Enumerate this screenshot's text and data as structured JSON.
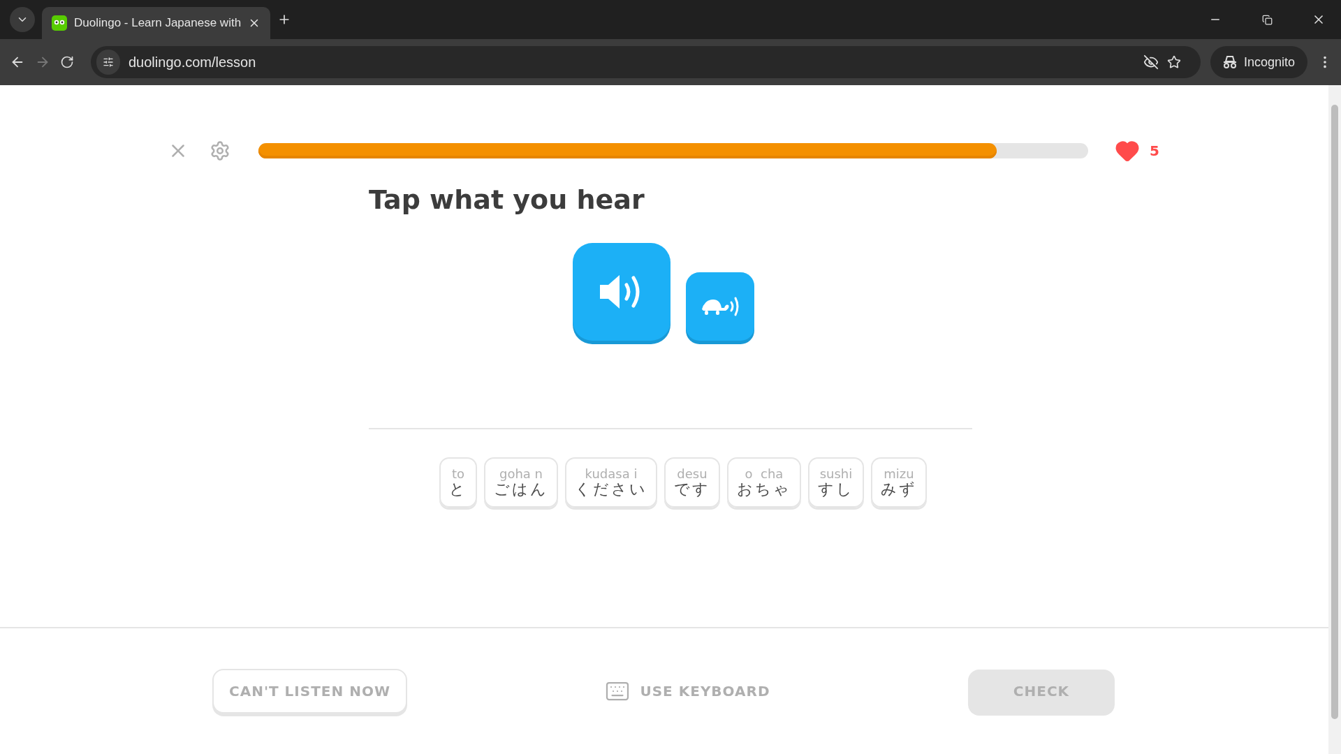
{
  "browser": {
    "tabs": [
      {
        "title": "Duolingo - Learn Japanese with",
        "selected": true
      }
    ],
    "url": "duolingo.com/lesson",
    "profile": "Incognito"
  },
  "lesson": {
    "progress": {
      "level": 0.89
    },
    "hearts": "5",
    "prompt": "Tap what you hear",
    "tiles": [
      {
        "reading": "to",
        "text": "と"
      },
      {
        "reading": "goha n",
        "text": "ごはん"
      },
      {
        "reading": "kudasa i",
        "text": "ください"
      },
      {
        "reading": "desu",
        "text": "です"
      },
      {
        "reading": "o  cha",
        "text": "おちゃ"
      },
      {
        "reading": "sushi",
        "text": "すし"
      },
      {
        "reading": "mizu",
        "text": "みず"
      }
    ]
  },
  "footer": {
    "skip": "CAN'T LISTEN NOW",
    "keyboard": "USE KEYBOARD",
    "check": {
      "label": "CHECK",
      "disabled": true
    }
  }
}
